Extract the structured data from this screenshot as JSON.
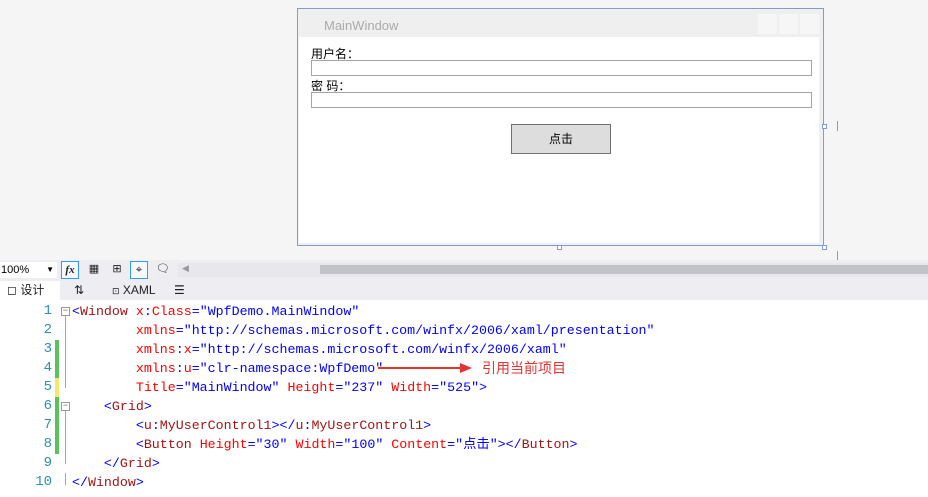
{
  "designer": {
    "window_title": "MainWindow",
    "username_label": "用户名：",
    "password_label": "密 码：",
    "username_value": "",
    "password_value": "",
    "button_label": "点击"
  },
  "toolbar": {
    "zoom": "100%",
    "fx_label": "fx"
  },
  "tabs": {
    "design": "设计",
    "swap": "⇅",
    "xaml": "XAML"
  },
  "annotation": "引用当前项目",
  "colors": {
    "accent": "#7f9bd8",
    "annotation": "#e53333",
    "changed": "#57c35a",
    "unsaved": "#f7e86c"
  },
  "code": {
    "lines": [
      {
        "n": "1",
        "mark": "none",
        "fold": "open",
        "tokens": [
          {
            "t": "<",
            "c": "b"
          },
          {
            "t": "Window",
            "c": "r"
          },
          {
            "t": " x",
            "c": "a"
          },
          {
            "t": ":",
            "c": "b"
          },
          {
            "t": "Class",
            "c": "a"
          },
          {
            "t": "=\"",
            "c": "b"
          },
          {
            "t": "WpfDemo.MainWindow",
            "c": "v"
          },
          {
            "t": "\"",
            "c": "b"
          }
        ]
      },
      {
        "n": "2",
        "mark": "none",
        "tokens": [
          {
            "t": "        xmlns",
            "c": "a"
          },
          {
            "t": "=\"",
            "c": "b"
          },
          {
            "t": "http://schemas.microsoft.com/winfx/2006/xaml/presentation",
            "c": "v"
          },
          {
            "t": "\"",
            "c": "b"
          }
        ]
      },
      {
        "n": "3",
        "mark": "changed",
        "tokens": [
          {
            "t": "        xmlns",
            "c": "a"
          },
          {
            "t": ":",
            "c": "b"
          },
          {
            "t": "x",
            "c": "a"
          },
          {
            "t": "=\"",
            "c": "b"
          },
          {
            "t": "http://schemas.microsoft.com/winfx/2006/xaml",
            "c": "v"
          },
          {
            "t": "\"",
            "c": "b"
          }
        ]
      },
      {
        "n": "4",
        "mark": "changed",
        "tokens": [
          {
            "t": "        xmlns",
            "c": "a"
          },
          {
            "t": ":",
            "c": "b"
          },
          {
            "t": "u",
            "c": "a"
          },
          {
            "t": "=\"",
            "c": "b"
          },
          {
            "t": "clr-namespace:WpfDemo",
            "c": "v"
          },
          {
            "t": "\"",
            "c": "b"
          }
        ]
      },
      {
        "n": "5",
        "mark": "unsaved",
        "tokens": [
          {
            "t": "        Title",
            "c": "a"
          },
          {
            "t": "=\"",
            "c": "b"
          },
          {
            "t": "MainWindow",
            "c": "v"
          },
          {
            "t": "\"",
            "c": "b"
          },
          {
            "t": " Height",
            "c": "a"
          },
          {
            "t": "=\"",
            "c": "b"
          },
          {
            "t": "237",
            "c": "v"
          },
          {
            "t": "\"",
            "c": "b"
          },
          {
            "t": " Width",
            "c": "a"
          },
          {
            "t": "=\"",
            "c": "b"
          },
          {
            "t": "525",
            "c": "v"
          },
          {
            "t": "\">",
            "c": "b"
          }
        ]
      },
      {
        "n": "6",
        "mark": "changed",
        "fold": "open",
        "tokens": [
          {
            "t": "    <",
            "c": "b"
          },
          {
            "t": "Grid",
            "c": "r"
          },
          {
            "t": ">",
            "c": "b"
          }
        ]
      },
      {
        "n": "7",
        "mark": "changed",
        "tokens": [
          {
            "t": "        <",
            "c": "b"
          },
          {
            "t": "u",
            "c": "r"
          },
          {
            "t": ":",
            "c": "b"
          },
          {
            "t": "MyUserControl1",
            "c": "r"
          },
          {
            "t": "></",
            "c": "b"
          },
          {
            "t": "u",
            "c": "r"
          },
          {
            "t": ":",
            "c": "b"
          },
          {
            "t": "MyUserControl1",
            "c": "r"
          },
          {
            "t": ">",
            "c": "b"
          }
        ]
      },
      {
        "n": "8",
        "mark": "changed",
        "tokens": [
          {
            "t": "        <",
            "c": "b"
          },
          {
            "t": "Button",
            "c": "r"
          },
          {
            "t": " Height",
            "c": "a"
          },
          {
            "t": "=\"",
            "c": "b"
          },
          {
            "t": "30",
            "c": "v"
          },
          {
            "t": "\"",
            "c": "b"
          },
          {
            "t": " Width",
            "c": "a"
          },
          {
            "t": "=\"",
            "c": "b"
          },
          {
            "t": "100",
            "c": "v"
          },
          {
            "t": "\"",
            "c": "b"
          },
          {
            "t": " Content",
            "c": "a"
          },
          {
            "t": "=\"",
            "c": "b"
          },
          {
            "t": "点击",
            "c": "v"
          },
          {
            "t": "\"></",
            "c": "b"
          },
          {
            "t": "Button",
            "c": "r"
          },
          {
            "t": ">",
            "c": "b"
          }
        ]
      },
      {
        "n": "9",
        "mark": "none",
        "tokens": [
          {
            "t": "    </",
            "c": "b"
          },
          {
            "t": "Grid",
            "c": "r"
          },
          {
            "t": ">",
            "c": "b"
          }
        ]
      },
      {
        "n": "10",
        "mark": "none",
        "tokens": [
          {
            "t": "</",
            "c": "b"
          },
          {
            "t": "Window",
            "c": "r"
          },
          {
            "t": ">",
            "c": "b"
          }
        ]
      }
    ]
  }
}
